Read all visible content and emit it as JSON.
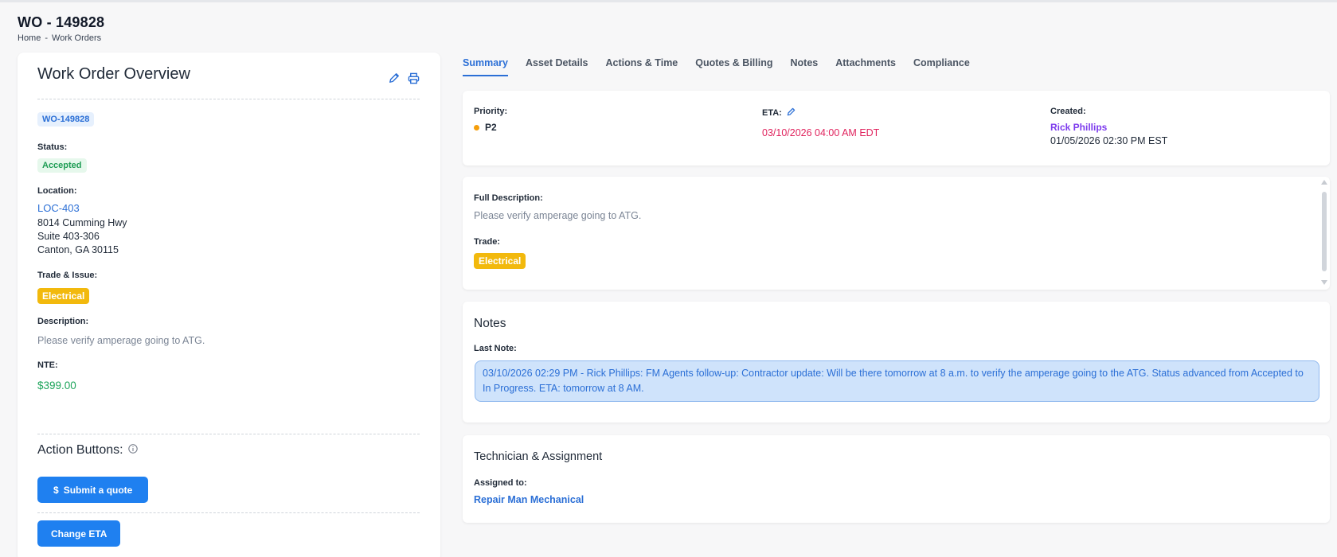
{
  "header": {
    "title": "WO - 149828",
    "breadcrumb": [
      "Home",
      "-",
      "Work Orders"
    ]
  },
  "overview": {
    "title": "Work Order Overview",
    "icons": [
      "pencil-icon",
      "printer-icon"
    ],
    "wo_badge": "WO-149828",
    "status_label": "Status:",
    "status_value": "Accepted",
    "location_label": "Location:",
    "location_code": "LOC-403",
    "address": [
      "8014 Cumming Hwy",
      "Suite 403-306",
      "Canton, GA 30115"
    ],
    "trade_label": "Trade & Issue:",
    "trade_value": "Electrical",
    "description_label": "Description:",
    "description_value": "Please verify amperage going to ATG.",
    "nte_label": "NTE:",
    "nte_value": "$399.00",
    "action_title": "Action Buttons:",
    "submit_quote": "Submit a quote",
    "submit_quote_icon": "$",
    "change_eta": "Change ETA"
  },
  "tabs": [
    {
      "label": "Summary",
      "active": true
    },
    {
      "label": "Asset Details",
      "active": false
    },
    {
      "label": "Actions & Time",
      "active": false
    },
    {
      "label": "Quotes & Billing",
      "active": false
    },
    {
      "label": "Notes",
      "active": false
    },
    {
      "label": "Attachments",
      "active": false
    },
    {
      "label": "Compliance",
      "active": false
    }
  ],
  "summary": {
    "priority_label": "Priority:",
    "priority_value": "P2",
    "eta_label": "ETA:",
    "eta_value": "03/10/2026 04:00 AM EDT",
    "created_label": "Created:",
    "created_by": "Rick Phillips",
    "created_date": "01/05/2026 02:30 PM EST"
  },
  "details": {
    "full_desc_label": "Full Description:",
    "full_desc_value": "Please verify amperage going to ATG.",
    "trade_label": "Trade:",
    "trade_value": "Electrical"
  },
  "notes": {
    "title": "Notes",
    "last_note_label": "Last Note:",
    "last_note": "03/10/2026 02:29 PM - Rick Phillips: FM Agents follow-up: Contractor update: Will be there tomorrow at 8 a.m. to verify the amperage going to the ATG. Status advanced from Accepted to In Progress. ETA: tomorrow at 8 AM."
  },
  "technician": {
    "title": "Technician & Assignment",
    "assigned_label": "Assigned to:",
    "assigned_value": "Repair Man Mechanical"
  },
  "colors": {
    "accent": "#1f80f0",
    "link": "#2b6fd6",
    "status_green": "#1f9d55",
    "trade_yellow": "#f2b90d",
    "priority_orange": "#f59e0b",
    "eta_red": "#e0245e",
    "creator_purple": "#7c3aed"
  }
}
